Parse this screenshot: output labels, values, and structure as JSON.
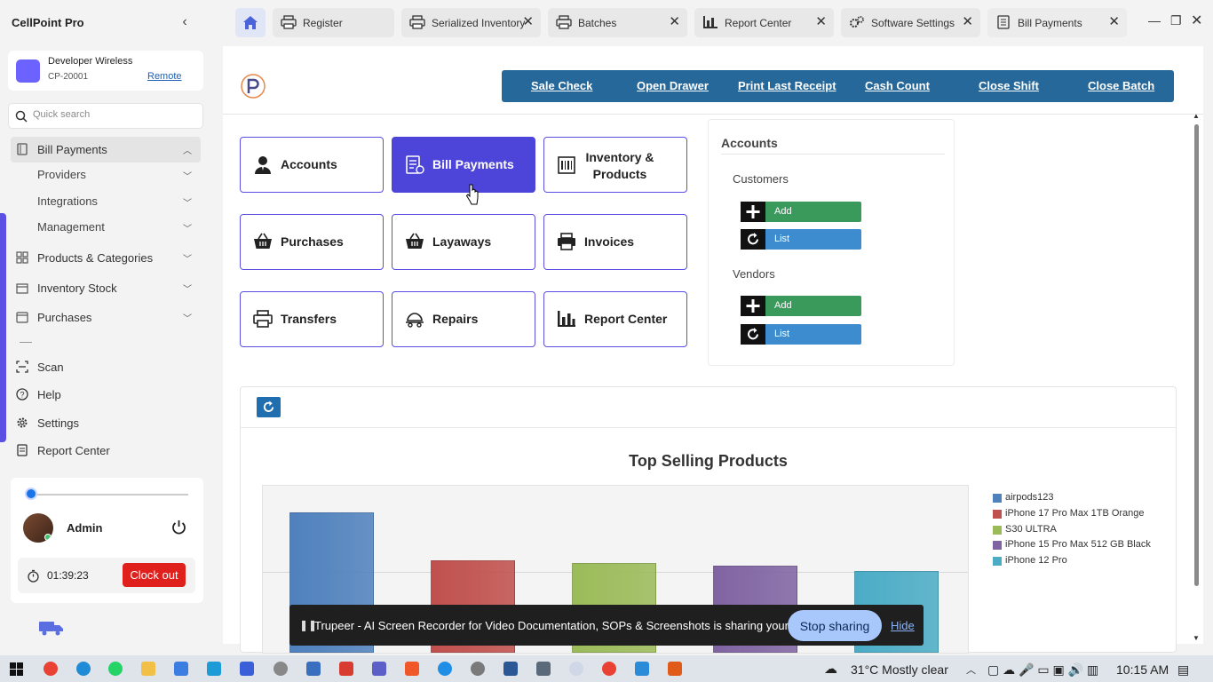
{
  "app": {
    "title": "CellPoint Pro",
    "collapse_glyph": "‹"
  },
  "store": {
    "name": "Developer Wireless",
    "id": "CP-20001",
    "remote_label": "Remote"
  },
  "search": {
    "placeholder": "Quick search"
  },
  "sidebar": {
    "items": [
      {
        "label": "Bill Payments",
        "icon": "receipt-icon",
        "expanded": true
      },
      {
        "label": "Providers"
      },
      {
        "label": "Integrations"
      },
      {
        "label": "Management"
      },
      {
        "label": "Products & Categories",
        "icon": "tag-icon"
      },
      {
        "label": "Inventory Stock",
        "icon": "box-icon"
      },
      {
        "label": "Purchases",
        "icon": "basket-icon"
      },
      {
        "label": "Scan",
        "icon": "scan-icon"
      },
      {
        "label": "Help",
        "icon": "help-icon"
      },
      {
        "label": "Settings",
        "icon": "gear-icon"
      },
      {
        "label": "Report Center",
        "icon": "report-icon"
      }
    ]
  },
  "user": {
    "name": "Admin",
    "timer": "01:39:23",
    "clock_out_label": "Clock out"
  },
  "tabs": [
    {
      "label": "Register"
    },
    {
      "label": "Serialized Inventory"
    },
    {
      "label": "Batches"
    },
    {
      "label": "Report Center"
    },
    {
      "label": "Software Settings"
    },
    {
      "label": "Bill Payments"
    }
  ],
  "topbar": {
    "links": [
      "Sale Check",
      "Open Drawer",
      "Print Last Receipt",
      "Cash Count",
      "Close Shift",
      "Close Batch"
    ],
    "color": "#27689b"
  },
  "tiles": [
    {
      "label": "Accounts",
      "icon": "user-icon"
    },
    {
      "label": "Bill Payments",
      "icon": "bill-icon",
      "active": true
    },
    {
      "label_line1": "Inventory &",
      "label_line2": "Products",
      "icon": "barcode-icon"
    },
    {
      "label": "Purchases",
      "icon": "basket-icon"
    },
    {
      "label": "Layaways",
      "icon": "basket-icon"
    },
    {
      "label": "Invoices",
      "icon": "printer-icon"
    },
    {
      "label": "Transfers",
      "icon": "printer-icon"
    },
    {
      "label": "Repairs",
      "icon": "repair-icon"
    },
    {
      "label": "Report Center",
      "icon": "chart-icon"
    }
  ],
  "accounts_panel": {
    "title": "Accounts",
    "customers": {
      "label": "Customers",
      "add": "Add",
      "list": "List"
    },
    "vendors": {
      "label": "Vendors",
      "add": "Add",
      "list": "List"
    }
  },
  "chart_data": {
    "type": "bar",
    "title": "Top Selling Products",
    "categories": [
      "airpods123",
      "iPhone 17 Pro Max 1TB Orange",
      "S30 ULTRA",
      "iPhone 15 Pro Max 512 GB Black",
      "iPhone 12 Pro"
    ],
    "values": [
      10,
      6.6,
      6.4,
      6.2,
      5.8
    ],
    "colors": [
      "#4f81bd",
      "#c0504d",
      "#9bbb59",
      "#8064a2",
      "#4bacc6"
    ],
    "ylim": [
      0,
      12
    ],
    "legend": "right",
    "grid": true,
    "xlabel": "",
    "ylabel": ""
  },
  "screen_share": {
    "message": "Trupeer - AI Screen Recorder for Video Documentation, SOPs & Screenshots is sharing your screen.",
    "stop_label": "Stop sharing",
    "hide_label": "Hide"
  },
  "taskbar": {
    "weather": "31°C  Mostly clear",
    "time": "10:15 AM"
  }
}
